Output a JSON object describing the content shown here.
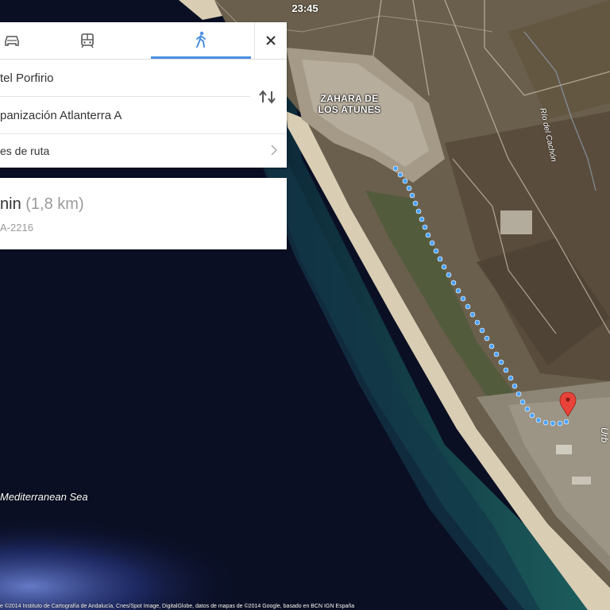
{
  "status": {
    "time": "23:45"
  },
  "map": {
    "town_label": "ZAHARA DE LOS ATUNES",
    "sea_label": "Mediterranean Sea",
    "road_labels": [
      "Río del Cachón",
      "Urb"
    ]
  },
  "directions": {
    "modes": [
      {
        "name": "car",
        "icon": "car-icon"
      },
      {
        "name": "transit",
        "icon": "train-icon"
      },
      {
        "name": "walk",
        "icon": "walking-icon",
        "selected": true
      }
    ],
    "origin": "tel Porfirio",
    "destination": "panización Atlanterra A",
    "options_label": "es de ruta"
  },
  "route": {
    "duration": "nin",
    "distance": "(1,8 km)",
    "via": "A-2216"
  },
  "attribution": "e ©2014 Instituto de Cartografía de Andalucía, Cnes/Spot Image, DigitalGlobe, datos de mapas de ©2014 Google, basado en BCN IGN España",
  "colors": {
    "accent": "#4a8fe3",
    "route_dot": "#4aa3ff",
    "pin": "#e8433a"
  }
}
